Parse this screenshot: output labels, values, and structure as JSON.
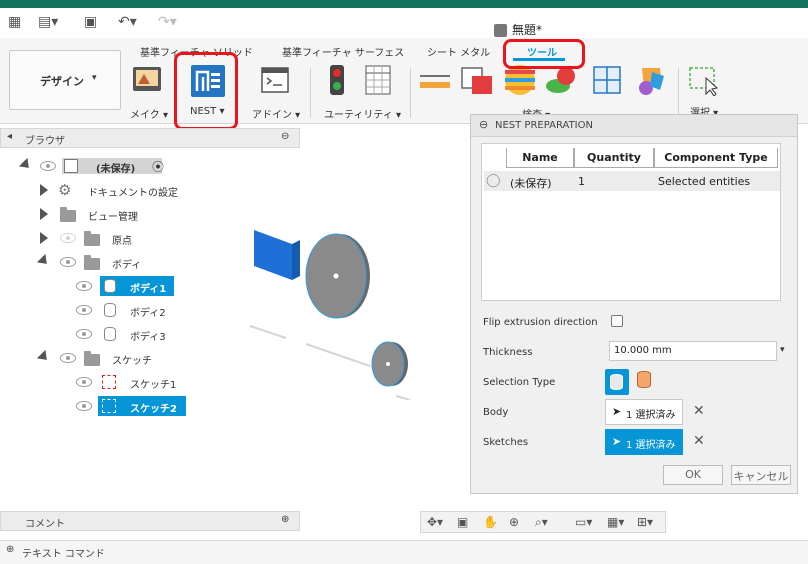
{
  "document": {
    "title": "無題*"
  },
  "ribbon": {
    "tabs": [
      "基準フィーチャ ソリッド",
      "基準フィーチャ サーフェス",
      "シート メタル",
      "ツール"
    ],
    "active_tab": "ツール",
    "workspace_button": "デザイン",
    "tools": [
      "メイク",
      "NEST",
      "アドイン",
      "ユーティリティ",
      "検査",
      "選択"
    ]
  },
  "browser": {
    "title": "ブラウザ",
    "root": "(未保存)",
    "items": [
      "ドキュメントの設定",
      "ビュー管理",
      "原点",
      "ボディ",
      "ボディ1",
      "ボディ2",
      "ボディ3",
      "スケッチ",
      "スケッチ1",
      "スケッチ2"
    ]
  },
  "comments": {
    "label": "コメント"
  },
  "text_command": {
    "label": "テキスト コマンド"
  },
  "nest_panel": {
    "title": "NEST PREPARATION",
    "columns": [
      "Name",
      "Quantity",
      "Component Type"
    ],
    "rows": [
      {
        "name": "(未保存)",
        "quantity": "1",
        "type": "Selected entities"
      }
    ],
    "flip_label": "Flip extrusion direction",
    "thickness_label": "Thickness",
    "thickness_value": "10.000 mm",
    "selection_type_label": "Selection Type",
    "body_label": "Body",
    "body_value": "1 選択済み",
    "sketches_label": "Sketches",
    "sketches_value": "1 選択済み",
    "ok_label": "OK",
    "cancel_label": "キャンセル"
  },
  "colors": {
    "accent": "#0696d7",
    "highlight": "#e8151b",
    "titlebar": "#12735f"
  }
}
